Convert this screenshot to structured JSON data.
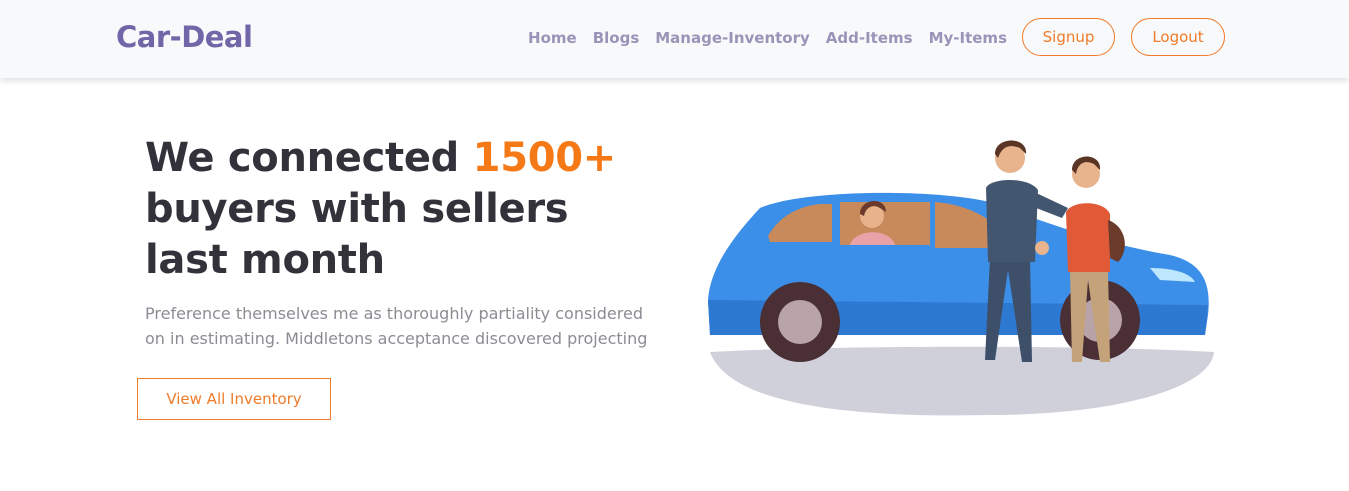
{
  "brand": "Car-Deal",
  "nav": {
    "links": [
      "Home",
      "Blogs",
      "Manage-Inventory",
      "Add-Items",
      "My-Items"
    ],
    "signup": "Signup",
    "logout": "Logout"
  },
  "hero": {
    "title_pre": "We connected ",
    "title_accent": "1500+",
    "title_post": "buyers with sellers last month",
    "subtitle": "Preference themselves me as thoroughly partiality considered on in estimating. Middletons acceptance discovered projecting",
    "cta": "View All Inventory"
  },
  "colors": {
    "brand": "#7066a8",
    "accent": "#f57a17",
    "nav_link": "#9a94b8",
    "car": "#3b8fe8"
  },
  "illustration": "car-handshake-illustration"
}
